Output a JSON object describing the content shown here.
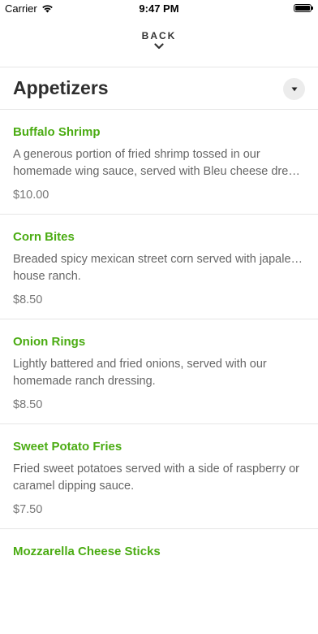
{
  "status_bar": {
    "carrier": "Carrier",
    "time": "9:47 PM"
  },
  "nav": {
    "back_label": "BACK"
  },
  "section": {
    "title": "Appetizers"
  },
  "items": [
    {
      "name": "Buffalo Shrimp",
      "desc_line1": "A generous portion of fried shrimp tossed in our",
      "desc_line2": "homemade wing sauce, served with Bleu cheese dressin...",
      "price": "$10.00"
    },
    {
      "name": "Corn Bites",
      "desc_line1": "Breaded spicy mexican street corn served with japaleno or",
      "desc_line2": "house ranch.",
      "price": "$8.50"
    },
    {
      "name": "Onion Rings",
      "desc_line1": "Lightly battered and fried onions, served with our",
      "desc_line2": "homemade ranch dressing.",
      "price": "$8.50"
    },
    {
      "name": "Sweet Potato Fries",
      "desc_line1": "Fried sweet potatoes served with a side of raspberry or",
      "desc_line2": "caramel dipping sauce.",
      "price": "$7.50"
    },
    {
      "name": "Mozzarella Cheese Sticks"
    }
  ],
  "colors": {
    "item_name": "#4bac13",
    "divider": "#e6e6e6"
  }
}
